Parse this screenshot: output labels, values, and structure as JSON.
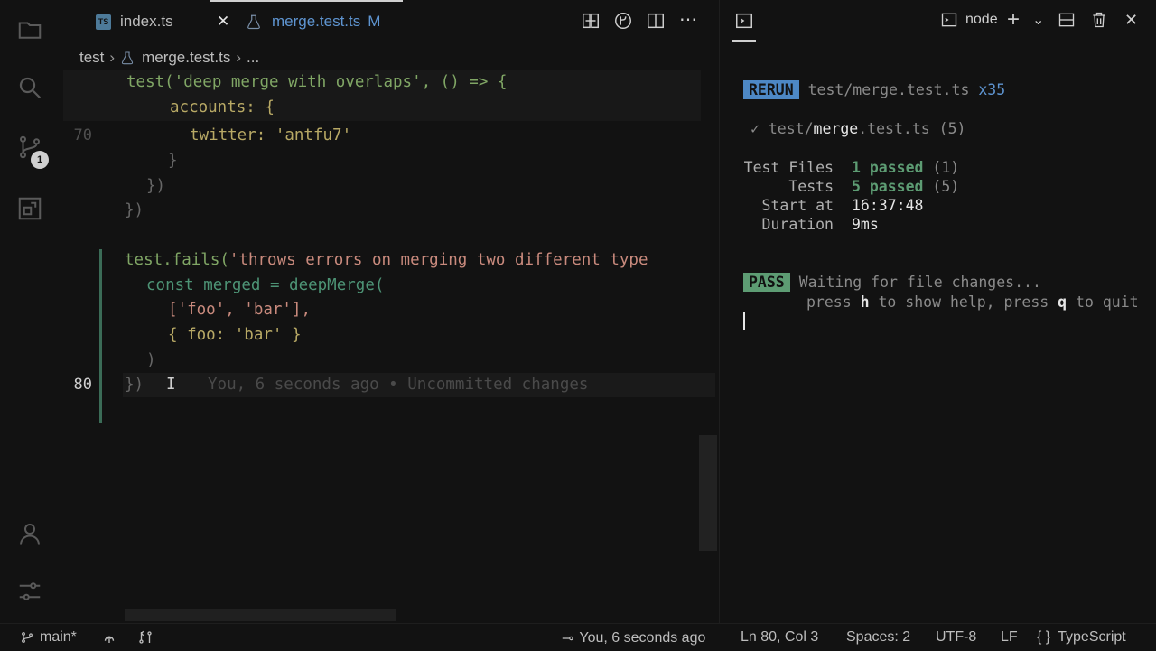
{
  "tabs": [
    {
      "icon": "TS",
      "label": "index.ts"
    },
    {
      "icon": "test",
      "label": "merge.test.ts",
      "badge": "M"
    }
  ],
  "breadcrumb": [
    "test",
    "merge.test.ts",
    "..."
  ],
  "scm_badge": "1",
  "code": {
    "sticky_line1": "test('deep merge with overlaps', () => {",
    "sticky_line2": "accounts: {",
    "line70_num": "70",
    "line80_num": "80",
    "l70": "twitter: 'antfu7'",
    "l71": "}",
    "l72": "})",
    "l73": "})",
    "l75_a": "test.fails(",
    "l75_b": "'throws errors on merging two different type",
    "l76": "const merged = deepMerge(",
    "l77": "['foo', 'bar'],",
    "l78": "{ foo: 'bar' }",
    "l79": ")",
    "l80": "})",
    "blame": "You, 6 seconds ago • Uncommitted changes"
  },
  "panel": {
    "shell": "node"
  },
  "terminal": {
    "rerun_label": "RERUN",
    "rerun_file": "test/merge.test.ts",
    "rerun_count": "x35",
    "check_file_a": "✓ test/",
    "check_file_b": "merge",
    "check_file_c": ".test.ts",
    "check_count": "(5)",
    "test_files_label": "Test Files",
    "test_files_value": "1 passed",
    "test_files_count": "(1)",
    "tests_label": "Tests",
    "tests_value": "5 passed",
    "tests_count": "(5)",
    "start_label": "Start at",
    "start_value": "16:37:48",
    "duration_label": "Duration",
    "duration_value": "9ms",
    "pass_label": "PASS",
    "waiting": "Waiting for file changes...",
    "help_a": "press ",
    "help_h": "h",
    "help_b": " to show help, press ",
    "help_q": "q",
    "help_c": " to quit"
  },
  "status": {
    "branch": "main*",
    "blame": "You, 6 seconds ago",
    "position": "Ln 80, Col 3",
    "spaces": "Spaces: 2",
    "encoding": "UTF-8",
    "eol": "LF",
    "language": "TypeScript"
  }
}
